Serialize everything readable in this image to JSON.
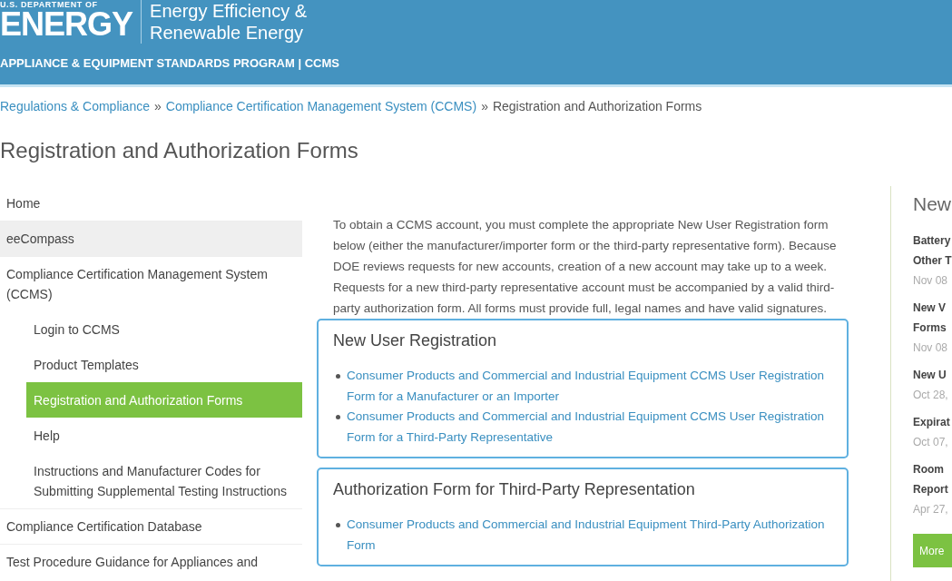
{
  "header": {
    "agency": "U.S. DEPARTMENT OF",
    "wordmark": "ENERGY",
    "office": "Energy Efficiency & Renewable Energy",
    "program": "APPLIANCE & EQUIPMENT STANDARDS PROGRAM | CCMS"
  },
  "breadcrumb": [
    {
      "kind": "link",
      "text": "Regulations & Compliance"
    },
    {
      "kind": "separator",
      "text": "»"
    },
    {
      "kind": "link",
      "text": "Compliance Certification Management System (CCMS)"
    },
    {
      "kind": "separator",
      "text": "»"
    },
    {
      "kind": "current",
      "text": "Registration and Authorization Forms"
    }
  ],
  "page_title": "Registration and Authorization Forms",
  "sidebar": {
    "items": [
      {
        "label": "Home",
        "selected": false,
        "hovered": false
      },
      {
        "label": "eeCompass",
        "selected": false,
        "hovered": true
      },
      {
        "label": "Compliance Certification Management System (CCMS)",
        "selected": false,
        "hovered": false,
        "children": [
          {
            "label": "Login to CCMS",
            "selected": false
          },
          {
            "label": "Product Templates",
            "selected": false
          },
          {
            "label": "Registration and Authorization Forms",
            "selected": true
          },
          {
            "label": "Help",
            "selected": false
          },
          {
            "label": "Instructions and Manufacturer Codes for Submitting Supplemental Testing Instructions",
            "selected": false
          }
        ]
      },
      {
        "label": "Compliance Certification Database",
        "selected": false,
        "hovered": false
      },
      {
        "label": "Test Procedure Guidance for Appliances and",
        "selected": false,
        "hovered": false
      }
    ]
  },
  "intro": "To obtain a CCMS account, you must complete the appropriate New User Registration form below (either the manufacturer/importer form or the third-party representative form). Because DOE reviews requests for new accounts, creation of a new account may take up to a week. Requests for a new third-party representative account must be accompanied by a valid third-party authorization form. All forms must provide full, legal names and have valid signatures.",
  "sections": [
    {
      "title": "New User Registration",
      "links": [
        "Consumer Products and Commercial and Industrial Equipment CCMS User Registration Form for a Manufacturer or an Importer",
        "Consumer Products and Commercial and Industrial Equipment CCMS User Registration Form for a Third-Party Representative"
      ]
    },
    {
      "title": "Authorization Form for Third-Party Representation",
      "links": [
        "Consumer Products and Commercial and Industrial Equipment Third-Party Authorization Form"
      ]
    }
  ],
  "news": {
    "heading": "New",
    "items": [
      {
        "title_lines": [
          "Battery",
          "Other T"
        ],
        "date": "Nov 08"
      },
      {
        "title_lines": [
          "New V",
          "Forms"
        ],
        "date": "Nov 08"
      },
      {
        "title_lines": [
          "New U"
        ],
        "date": "Oct 28,"
      },
      {
        "title_lines": [
          "Expirat"
        ],
        "date": "Oct 07,"
      },
      {
        "title_lines": [
          "Room",
          "Report"
        ],
        "date": "Apr 27,"
      }
    ],
    "more_button": "More"
  }
}
